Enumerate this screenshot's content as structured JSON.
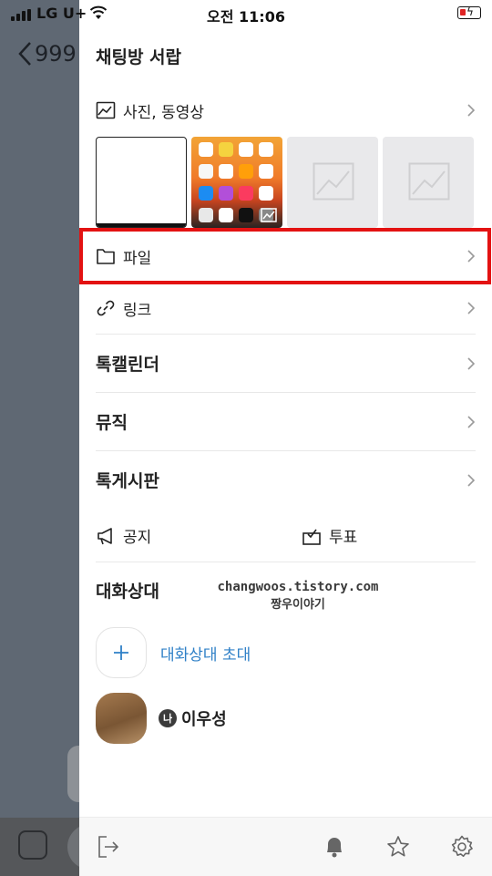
{
  "status_bar": {
    "carrier": "LG U+",
    "time": "오전 11:06"
  },
  "chat": {
    "title_partial": "999"
  },
  "drawer": {
    "title": "채팅방 서랍",
    "photos_label": "사진, 동영상",
    "file_label": "파일",
    "link_label": "링크",
    "talk_calendar_label": "톡캘린더",
    "music_label": "뮤직",
    "talk_board_label": "톡게시판",
    "notice_label": "공지",
    "vote_label": "투표",
    "members_heading": "대화상대",
    "invite_label": "대화상대 초대",
    "me_badge": "나",
    "member_name": "이우성"
  },
  "watermark": {
    "line1": "changwoos.tistory.com",
    "line2": "짱우이야기"
  },
  "colors": {
    "highlight": "#e31212",
    "invite_text": "#2f80c7"
  }
}
